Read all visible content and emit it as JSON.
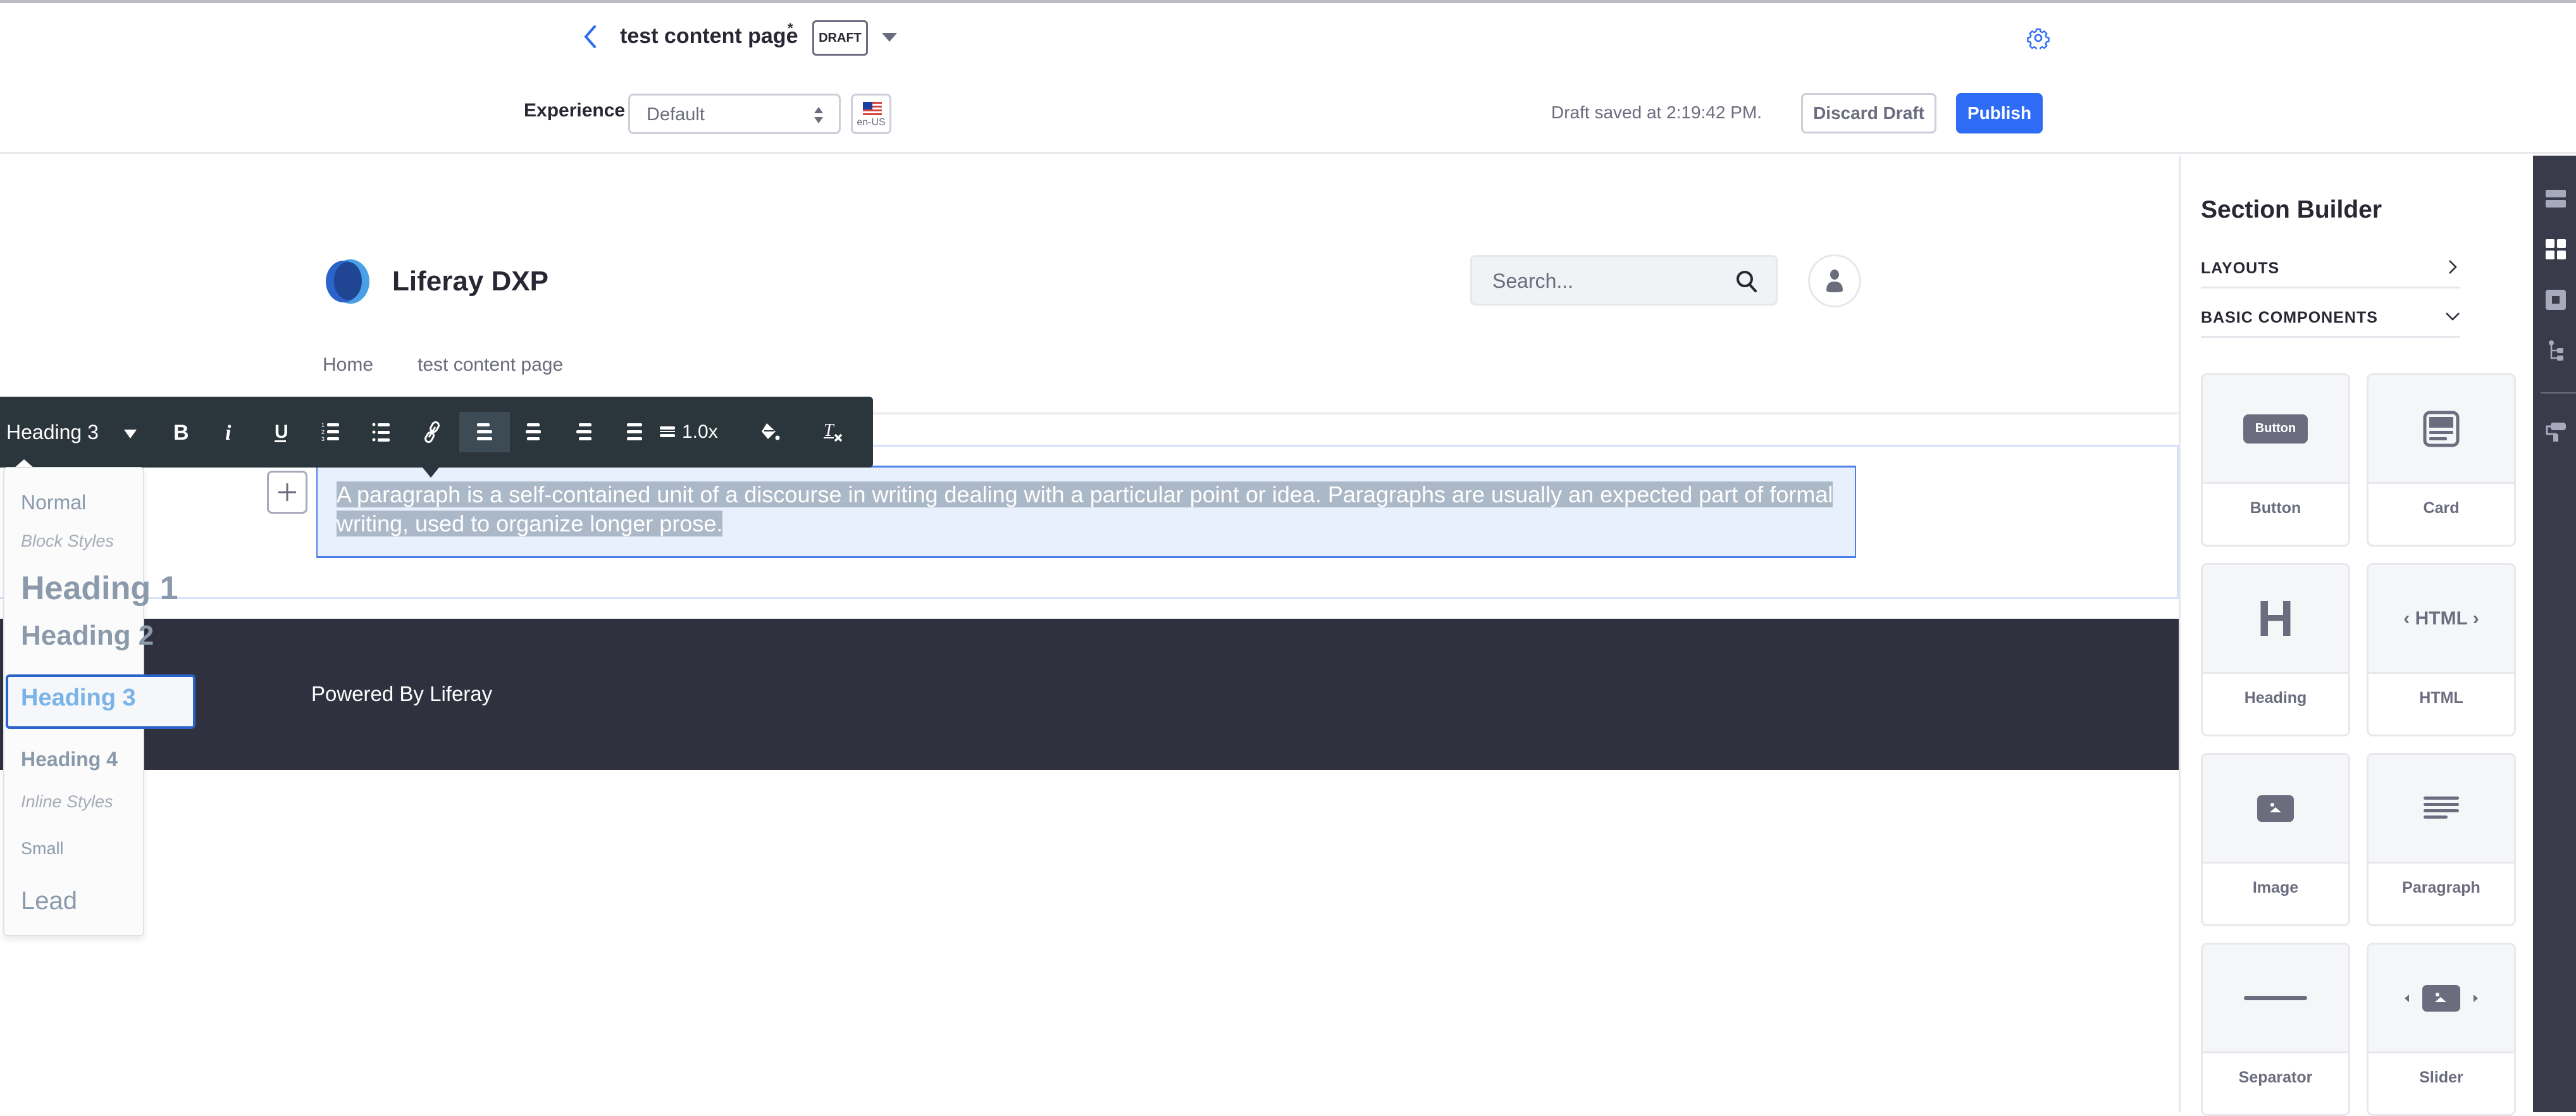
{
  "header": {
    "page_title": "test content page",
    "unsaved_marker": "*",
    "status_badge": "DRAFT",
    "experience_label": "Experience",
    "experience_value": "Default",
    "locale": "en-US",
    "draft_saved": "Draft saved at 2:19:42 PM.",
    "discard_label": "Discard Draft",
    "publish_label": "Publish"
  },
  "site": {
    "name": "Liferay DXP",
    "search_placeholder": "Search...",
    "nav": [
      "Home",
      "test content page"
    ]
  },
  "editor": {
    "text": "A paragraph is a self-contained unit of a discourse in writing dealing with a particular point or idea. Paragraphs are usually an expected part of formal writing, used to organize longer prose.",
    "toolbar": {
      "format_value": "Heading 3",
      "line_height": "1.0x",
      "buttons": [
        "bold",
        "italic",
        "underline",
        "ordered-list",
        "unordered-list",
        "link",
        "align-left",
        "align-center",
        "align-right",
        "align-justify",
        "line-height",
        "text-color",
        "remove-format"
      ],
      "active": "align-left"
    },
    "format_dropdown": {
      "items": [
        {
          "label": "Normal",
          "type": "option"
        },
        {
          "label": "Block Styles",
          "type": "group"
        },
        {
          "label": "Heading 1",
          "type": "option"
        },
        {
          "label": "Heading 2",
          "type": "option"
        },
        {
          "label": "Heading 3",
          "type": "option",
          "selected": true
        },
        {
          "label": "Heading 4",
          "type": "option"
        },
        {
          "label": "Inline Styles",
          "type": "group"
        },
        {
          "label": "Small",
          "type": "option"
        },
        {
          "label": "Lead",
          "type": "option"
        }
      ]
    }
  },
  "footer": {
    "text": "Powered By Liferay"
  },
  "sidebar": {
    "title": "Section Builder",
    "sections": [
      {
        "label": "LAYOUTS",
        "expanded": false
      },
      {
        "label": "BASIC COMPONENTS",
        "expanded": true
      }
    ],
    "components": [
      {
        "label": "Button",
        "icon": "button-icon",
        "preview_text": "Button"
      },
      {
        "label": "Card",
        "icon": "card-icon"
      },
      {
        "label": "Heading",
        "icon": "heading-icon",
        "preview_text": "H"
      },
      {
        "label": "HTML",
        "icon": "html-icon",
        "preview_text": "HTML"
      },
      {
        "label": "Image",
        "icon": "image-icon"
      },
      {
        "label": "Paragraph",
        "icon": "paragraph-icon"
      },
      {
        "label": "Separator",
        "icon": "separator-icon"
      },
      {
        "label": "Slider",
        "icon": "slider-icon"
      }
    ]
  },
  "rail": {
    "items": [
      "sections-icon",
      "fragments-icon",
      "widgets-icon",
      "page-structure-icon",
      "look-and-feel-icon"
    ],
    "active": "fragments-icon"
  },
  "colors": {
    "accent": "#2e6cf6",
    "toolbar_bg": "#2b353c",
    "footer_bg": "#30313f",
    "rail_bg": "#393a4a",
    "selection_bg": "#abb8c7",
    "editable_bg": "#e8effd"
  }
}
